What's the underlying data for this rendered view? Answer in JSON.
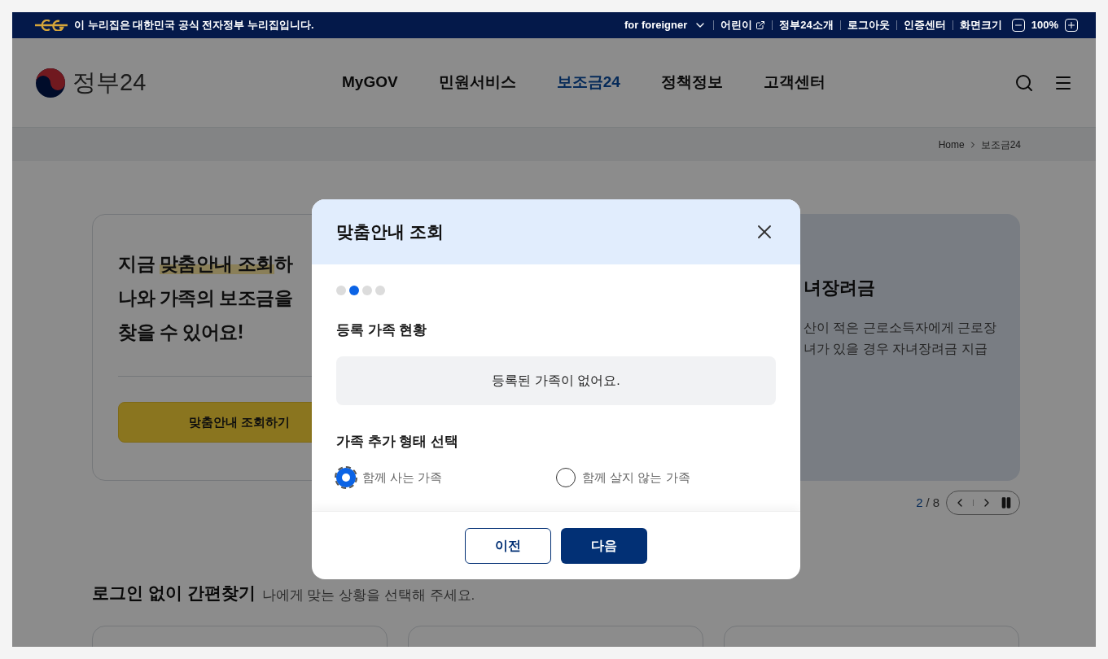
{
  "top_bar": {
    "notice": "이 누리집은 대한민국 공식 전자정부 누리집입니다.",
    "links": [
      {
        "label": "for foreigner",
        "kind": "dropdown"
      },
      {
        "label": "어린이",
        "kind": "external"
      },
      {
        "label": "정부24소개",
        "kind": "plain"
      },
      {
        "label": "로그아웃",
        "kind": "plain"
      },
      {
        "label": "인증센터",
        "kind": "plain"
      }
    ],
    "zoom": {
      "label": "화면크기",
      "value": "100%"
    }
  },
  "header": {
    "logo": "정부24",
    "nav": [
      {
        "label": "MyGOV",
        "selected": false
      },
      {
        "label": "민원서비스",
        "selected": false
      },
      {
        "label": "보조금24",
        "selected": true
      },
      {
        "label": "정책정보",
        "selected": false
      },
      {
        "label": "고객센터",
        "selected": false
      }
    ]
  },
  "breadcrumb": [
    "Home",
    "보조금24"
  ],
  "hero": {
    "title_lines": [
      [
        {
          "text": "지금 ",
          "highlighted": false
        },
        {
          "text": "맞춤안내 조회",
          "highlighted": true
        },
        {
          "text": "하",
          "highlighted": false
        }
      ],
      [
        {
          "text": "나와 가족의 보조금을",
          "highlighted": false
        }
      ],
      [
        {
          "text": "찾을 수 있어요!",
          "highlighted": false
        }
      ]
    ],
    "button": "맞춤안내 조회하기"
  },
  "slide": {
    "title": "녀장려금",
    "description_lines": [
      "산이 적은 근로소득자에게 근로장",
      "녀가 있을 경우 자녀장려금 지급"
    ]
  },
  "pager": {
    "current": "2",
    "separator": "/",
    "total": "8"
  },
  "quick_find": {
    "title": "로그인 없이 간편찾기",
    "subtitle": "나에게 맞는 상황을 선택해 주세요."
  },
  "modal": {
    "title": "맞춤안내 조회",
    "steps": [
      {
        "selected": false
      },
      {
        "selected": true
      },
      {
        "selected": false
      },
      {
        "selected": false
      }
    ],
    "registered_title": "등록 가족 현황",
    "empty_message": "등록된 가족이 없어요.",
    "type_title": "가족 추가 형태 선택",
    "options": [
      {
        "label": "함께 사는 가족",
        "selected": true
      },
      {
        "label": "함께 살지 않는 가족",
        "selected": false
      }
    ],
    "buttons": [
      {
        "label": "이전",
        "kind": "secondary"
      },
      {
        "label": "다음",
        "kind": "primary"
      }
    ]
  }
}
